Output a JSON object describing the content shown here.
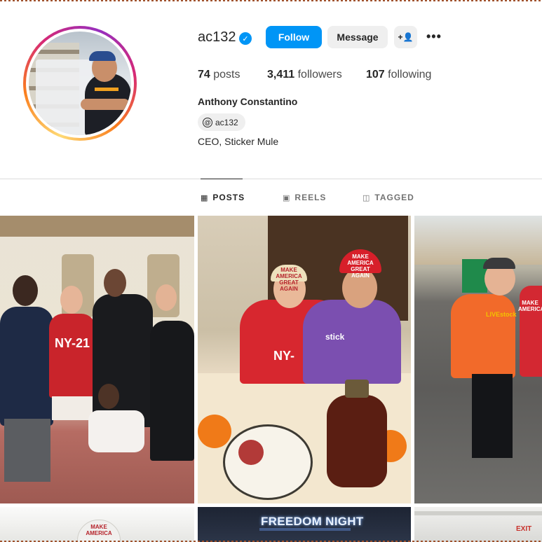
{
  "profile": {
    "username": "ac132",
    "verified_icon": "✓",
    "full_name": "Anthony Constantino",
    "threads_handle": "ac132",
    "bio": "CEO, Sticker Mule"
  },
  "actions": {
    "follow": "Follow",
    "message": "Message",
    "add_user_icon": "+👤",
    "more_icon": "•••"
  },
  "stats": {
    "posts_count": "74",
    "posts_label": "posts",
    "followers_count": "3,411",
    "followers_label": "followers",
    "following_count": "107",
    "following_label": "following"
  },
  "tabs": [
    {
      "label": "POSTS",
      "icon": "grid-icon",
      "active": true
    },
    {
      "label": "REELS",
      "icon": "reels-icon",
      "active": false
    },
    {
      "label": "TAGGED",
      "icon": "tagged-icon",
      "active": false
    }
  ],
  "posts_text": {
    "p1_shirt": "NY-21",
    "p2_shirt": "NY-",
    "p2_cap_left": "MAKE AMERICA GREAT AGAIN",
    "p2_cap_right": "MAKE AMERICA GREAT AGAIN",
    "p2_tshirt": "stick",
    "p3_shirt": "LIVEstock",
    "p3_shirt2": "MAKE AMERICA",
    "p4_cap": "MAKE AMERICA",
    "p5_title": "FREEDOM NIGHT",
    "p6_sign": "EXIT"
  },
  "colors": {
    "accent": "#0095f6",
    "secondary_button": "#efefef",
    "text": "#262626",
    "muted": "#737373",
    "divider": "#dbdbdb"
  }
}
